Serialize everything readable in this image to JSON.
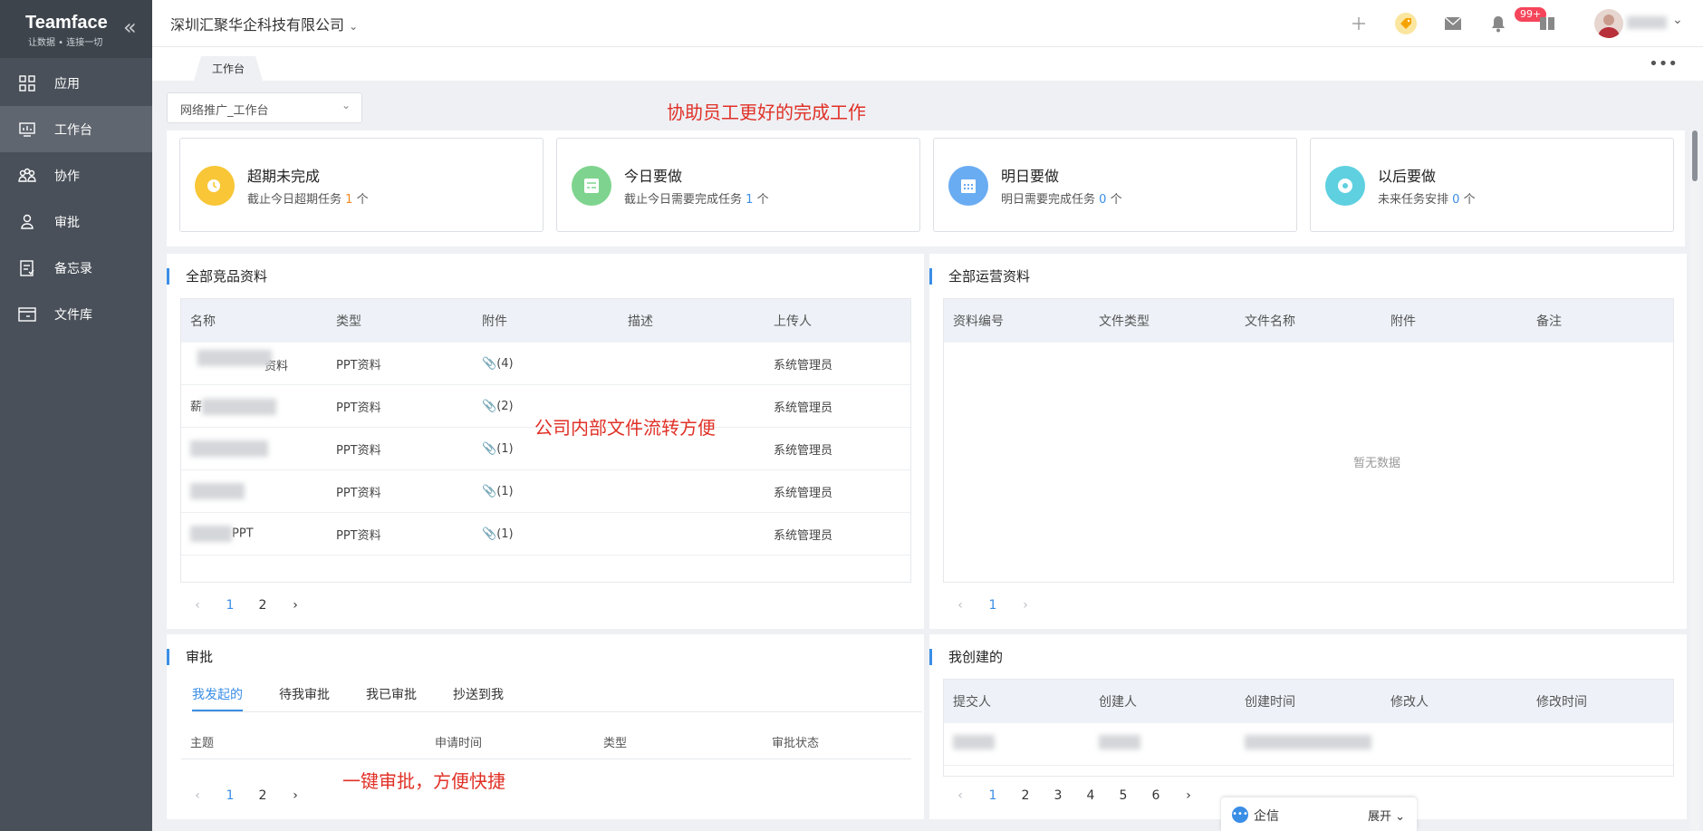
{
  "sidebar": {
    "logo": {
      "name": "Teamface",
      "slogan": "让数据 • 连接一切"
    },
    "items": [
      {
        "label": "应用",
        "icon": "apps-icon",
        "active": false
      },
      {
        "label": "工作台",
        "icon": "dashboard-icon",
        "active": true
      },
      {
        "label": "协作",
        "icon": "collaboration-icon",
        "active": false
      },
      {
        "label": "审批",
        "icon": "approval-icon",
        "active": false
      },
      {
        "label": "备忘录",
        "icon": "memo-icon",
        "active": false
      },
      {
        "label": "文件库",
        "icon": "folder-icon",
        "active": false
      }
    ]
  },
  "topbar": {
    "company": "深圳汇聚华企科技有限公司",
    "notification_badge": "99+",
    "icons": [
      "plus-icon",
      "tag-icon",
      "mail-icon",
      "bell-icon",
      "book-icon",
      "avatar",
      "chevron-down-icon"
    ]
  },
  "tabbar": {
    "active_tab": "工作台"
  },
  "workspace_select": "网络推广_工作台",
  "annotations": {
    "top": "协助员工更好的完成工作",
    "middle": "公司内部文件流转方便",
    "bottom": "一键审批，方便快捷"
  },
  "stats": [
    {
      "title": "超期未完成",
      "desc_prefix": "截止今日超期任务",
      "count": "1",
      "unit": "个",
      "color": "#f8c636",
      "num_color": "orange"
    },
    {
      "title": "今日要做",
      "desc_prefix": "截止今日需要完成任务",
      "count": "1",
      "unit": "个",
      "color": "#7ed48e",
      "num_color": "blue"
    },
    {
      "title": "明日要做",
      "desc_prefix": "明日需要完成任务",
      "count": "0",
      "unit": "个",
      "color": "#6aacf2",
      "num_color": "blue"
    },
    {
      "title": "以后要做",
      "desc_prefix": "未来任务安排",
      "count": "0",
      "unit": "个",
      "color": "#5fd0e0",
      "num_color": "blue"
    }
  ],
  "competitor_panel": {
    "title": "全部竞品资料",
    "columns": [
      "名称",
      "类型",
      "附件",
      "描述",
      "上传人"
    ],
    "rows": [
      {
        "name": "资料",
        "type": "PPT资料",
        "attach": "(4)",
        "desc": "",
        "uploader": "系统管理员"
      },
      {
        "name": "薪",
        "type": "PPT资料",
        "attach": "(2)",
        "desc": "",
        "uploader": "系统管理员"
      },
      {
        "name": "",
        "type": "PPT资料",
        "attach": "(1)",
        "desc": "",
        "uploader": "系统管理员"
      },
      {
        "name": "",
        "type": "PPT资料",
        "attach": "(1)",
        "desc": "",
        "uploader": "系统管理员"
      },
      {
        "name": "PPT",
        "type": "PPT资料",
        "attach": "(1)",
        "desc": "",
        "uploader": "系统管理员"
      }
    ],
    "pages": [
      "1",
      "2"
    ],
    "current_page": "1"
  },
  "operations_panel": {
    "title": "全部运营资料",
    "columns": [
      "资料编号",
      "文件类型",
      "文件名称",
      "附件",
      "备注"
    ],
    "empty_text": "暂无数据",
    "pages": [
      "1"
    ],
    "current_page": "1"
  },
  "approval_panel": {
    "title": "审批",
    "tabs": [
      "我发起的",
      "待我审批",
      "我已审批",
      "抄送到我"
    ],
    "active_tab": "我发起的",
    "columns": [
      "主题",
      "申请时间",
      "类型",
      "审批状态"
    ],
    "pages": [
      "1",
      "2"
    ],
    "current_page": "1"
  },
  "created_panel": {
    "title": "我创建的",
    "columns": [
      "提交人",
      "创建人",
      "创建时间",
      "修改人",
      "修改时间"
    ],
    "pages": [
      "1",
      "2",
      "3",
      "4",
      "5",
      "6"
    ],
    "current_page": "1"
  },
  "qixin": {
    "label": "企信",
    "expand": "展开"
  }
}
